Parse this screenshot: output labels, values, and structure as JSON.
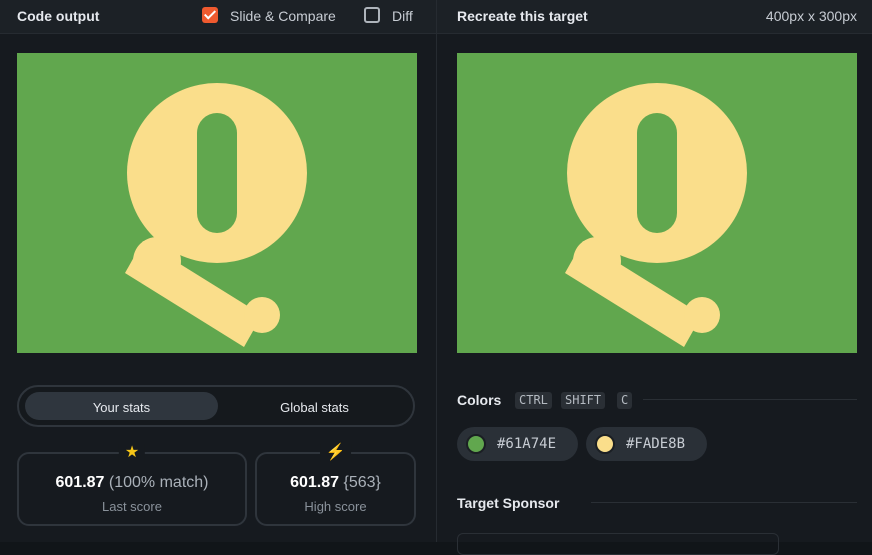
{
  "left_panel": {
    "title": "Code output",
    "slide_compare": {
      "label": "Slide & Compare",
      "checked": true
    },
    "diff": {
      "label": "Diff",
      "checked": false
    }
  },
  "right_panel": {
    "title": "Recreate this target",
    "dimensions": "400px x 300px"
  },
  "stats_tabs": {
    "your_stats": "Your stats",
    "global_stats": "Global stats",
    "active": "your_stats"
  },
  "last_score": {
    "icon": "star-icon",
    "value": "601.87",
    "extra": "(100% match)",
    "caption": "Last score"
  },
  "high_score": {
    "icon": "lightning-icon",
    "value": "601.87",
    "extra": "{563}",
    "caption": "High score"
  },
  "colors": {
    "title": "Colors",
    "shortcut": [
      "CTRL",
      "SHIFT",
      "C"
    ],
    "swatches": [
      {
        "hex": "#61A74E",
        "color": "#61a74e"
      },
      {
        "hex": "#FADE8B",
        "color": "#fade8b"
      }
    ]
  },
  "sponsor": {
    "title": "Target Sponsor"
  }
}
